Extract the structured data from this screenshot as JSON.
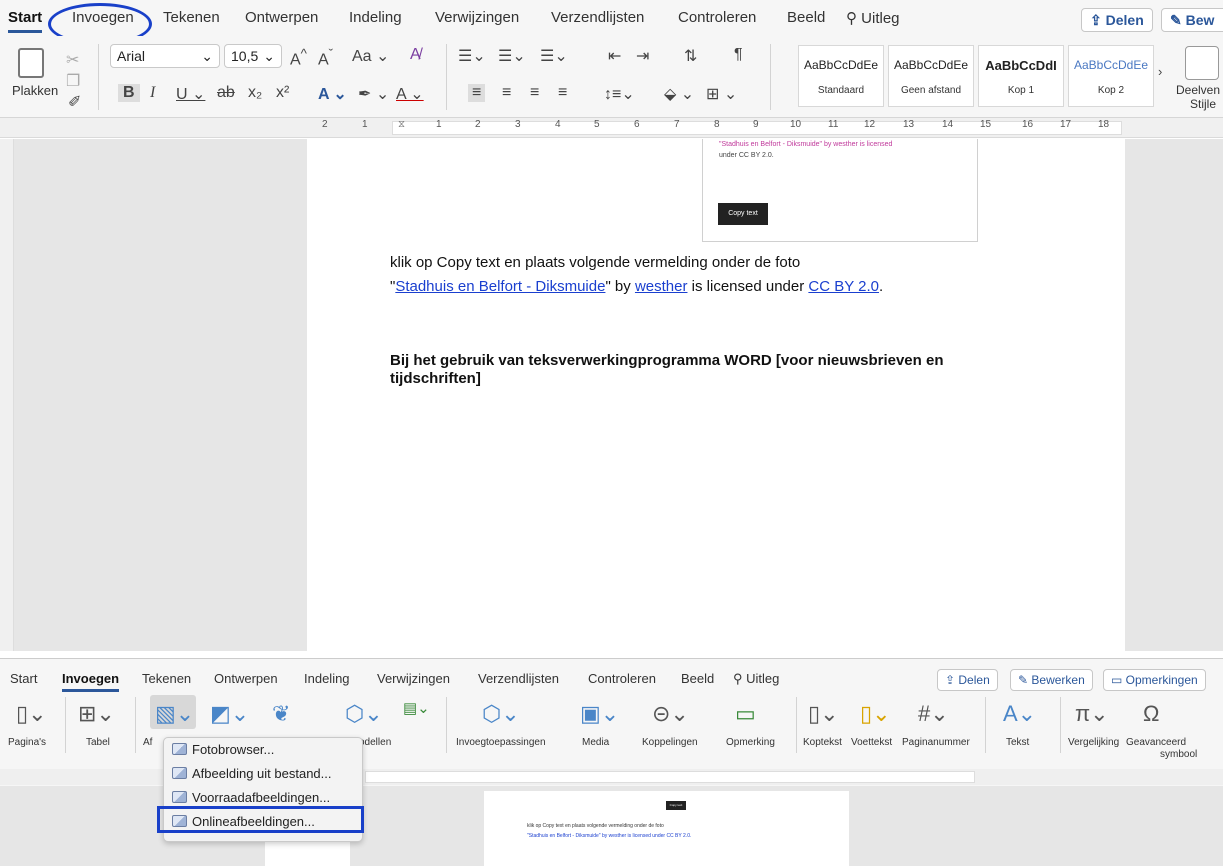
{
  "top": {
    "tabs": [
      "Start",
      "Invoegen",
      "Tekenen",
      "Ontwerpen",
      "Indeling",
      "Verwijzingen",
      "Verzendlijsten",
      "Controleren",
      "Beeld",
      "Uitleg"
    ],
    "share": "Delen",
    "edit": "Bew",
    "paste_label": "Plakken",
    "font_name": "Arial",
    "font_size": "10,5",
    "styles": [
      {
        "sample": "AaBbCcDdEe",
        "name": "Standaard"
      },
      {
        "sample": "AaBbCcDdEe",
        "name": "Geen afstand"
      },
      {
        "sample": "AaBbCcDdI",
        "name": "Kop 1"
      },
      {
        "sample": "AaBbCcDdEe",
        "name": "Kop 2"
      }
    ],
    "styles_pane": "Deelven",
    "styles_pane2": "Stijle",
    "ruler_numbers": [
      "2",
      "1",
      "1",
      "2",
      "3",
      "4",
      "5",
      "6",
      "7",
      "8",
      "9",
      "10",
      "11",
      "12",
      "13",
      "14",
      "15",
      "16",
      "17",
      "18"
    ]
  },
  "document": {
    "card_credit_line1": "\"Stadhuis en Belfort - Diksmuide\" by westher is licensed",
    "card_credit_line2": "under CC BY 2.0.",
    "copy_button": "Copy text",
    "instruction": "klik op Copy text en plaats volgende vermelding onder de foto",
    "credit_quote_open": "\"",
    "credit_title": "Stadhuis en Belfort - Diksmuide",
    "credit_by": "\" by ",
    "credit_author": "westher",
    "credit_licensed": " is licensed under ",
    "credit_license": "CC BY 2.0",
    "credit_end": ".",
    "heading_line1": "Bij het gebruik van teksverwerkingprogramma WORD [voor nieuwsbrieven en",
    "heading_line2": "tijdschriften]"
  },
  "bottom": {
    "tabs": [
      "Start",
      "Invoegen",
      "Tekenen",
      "Ontwerpen",
      "Indeling",
      "Verwijzingen",
      "Verzendlijsten",
      "Controleren",
      "Beeld",
      "Uitleg"
    ],
    "share": "Delen",
    "edit": "Bewerken",
    "comments": "Opmerkingen",
    "groups": [
      "Pagina's",
      "Tabel",
      "Af",
      "odellen",
      "Invoegtoepassingen",
      "Media",
      "Koppelingen",
      "Opmerking",
      "Koptekst",
      "Voettekst",
      "Paginanummer",
      "Tekst",
      "Vergelijking",
      "Geavanceerd",
      "symbool"
    ],
    "menu": [
      "Fotobrowser...",
      "Afbeelding uit bestand...",
      "Voorraadafbeeldingen...",
      "Onlineafbeeldingen..."
    ],
    "mini_copy": "Copy text",
    "mini_instruction": "klik op Copy text en plaats volgende vermelding onder de foto",
    "mini_credit": "\"Stadhuis en Belfort - Diksmuide\" by westher is licensed under CC BY 2.0."
  },
  "colors": {
    "accent": "#2b579a",
    "highlight": "#1940c9",
    "link": "#1a3fcf"
  }
}
